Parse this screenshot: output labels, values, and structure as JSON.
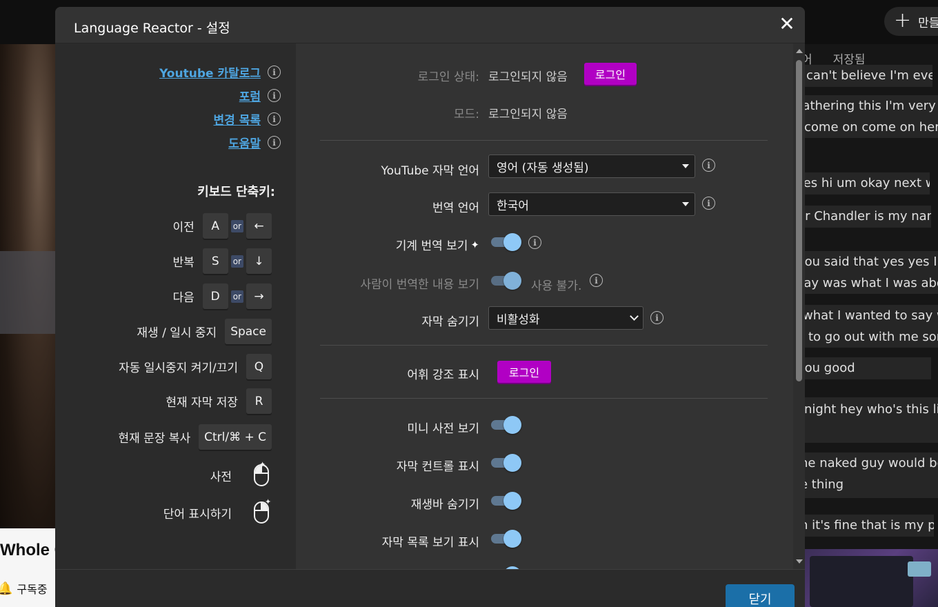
{
  "background": {
    "create_label": "만들기",
    "video_title_fragment": "Whole G",
    "subscribed_label": "구독중",
    "tabs": [
      "어",
      "저장됨"
    ],
    "subtitle_lines": [
      "I can't believe I'm even",
      "gathering this I'm very very",
      "come on come on here",
      "yes hi um okay next word",
      "er Chandler is my name",
      "you said that yes yes I can",
      "say was what I was about",
      "what I wanted to say was",
      "to go out with me some",
      "you good",
      "night hey who's this little",
      "he naked guy would be",
      "e thing",
      "h it's fine that is my pen"
    ]
  },
  "modal": {
    "title": "Language Reactor - 설정",
    "close_label": "닫기"
  },
  "links": {
    "catalog": "Youtube 카탈로그",
    "forum": "포럼",
    "changelog": "변경 목록",
    "help": "도움말"
  },
  "shortcuts": {
    "title": "키보드 단축키:",
    "or": "or",
    "prev": {
      "label": "이전",
      "key": "A",
      "alt": "←"
    },
    "repeat": {
      "label": "반복",
      "key": "S",
      "alt": "↓"
    },
    "next": {
      "label": "다음",
      "key": "D",
      "alt": "→"
    },
    "play": {
      "label": "재생 / 일시 중지",
      "key": "Space"
    },
    "autopause": {
      "label": "자동 일시중지 켜기/끄기",
      "key": "Q"
    },
    "save": {
      "label": "현재 자막 저장",
      "key": "R"
    },
    "copy": {
      "label": "현재 문장 복사",
      "key": "Ctrl/⌘ + C"
    },
    "dictionary": {
      "label": "사전"
    },
    "show_word": {
      "label": "단어 표시하기"
    }
  },
  "settings": {
    "login_status_label": "로그인 상태:",
    "login_status_value": "로그인되지 않음",
    "login_button": "로그인",
    "mode_label": "모드:",
    "mode_value": "로그인되지 않음",
    "yt_subtitle_label": "YouTube 자막 언어",
    "yt_subtitle_value": "영어 (자동 생성됨)",
    "translation_label": "번역 언어",
    "translation_value": "한국어",
    "machine_translation_label": "기계 번역 보기",
    "human_translation_label": "사람이 번역한 내용 보기",
    "human_translation_note": "사용 불가.",
    "hide_subtitles_label": "자막 숨기기",
    "hide_subtitles_value": "비활성화",
    "vocab_highlight_label": "어휘 강조 표시",
    "vocab_login_button": "로그인",
    "mini_dict_label": "미니 사전 보기",
    "subtitle_controls_label": "자막 컨트롤 표시",
    "hide_playbar_label": "재생바 숨기기",
    "subtitle_list_label": "자막 목록 보기 표시"
  },
  "colors": {
    "link": "#4ea5e0",
    "login_button": "#b100c4",
    "close_button": "#1b6fa8",
    "toggle_knob": "#8ec8f6",
    "toggle_track": "#5f7891"
  }
}
